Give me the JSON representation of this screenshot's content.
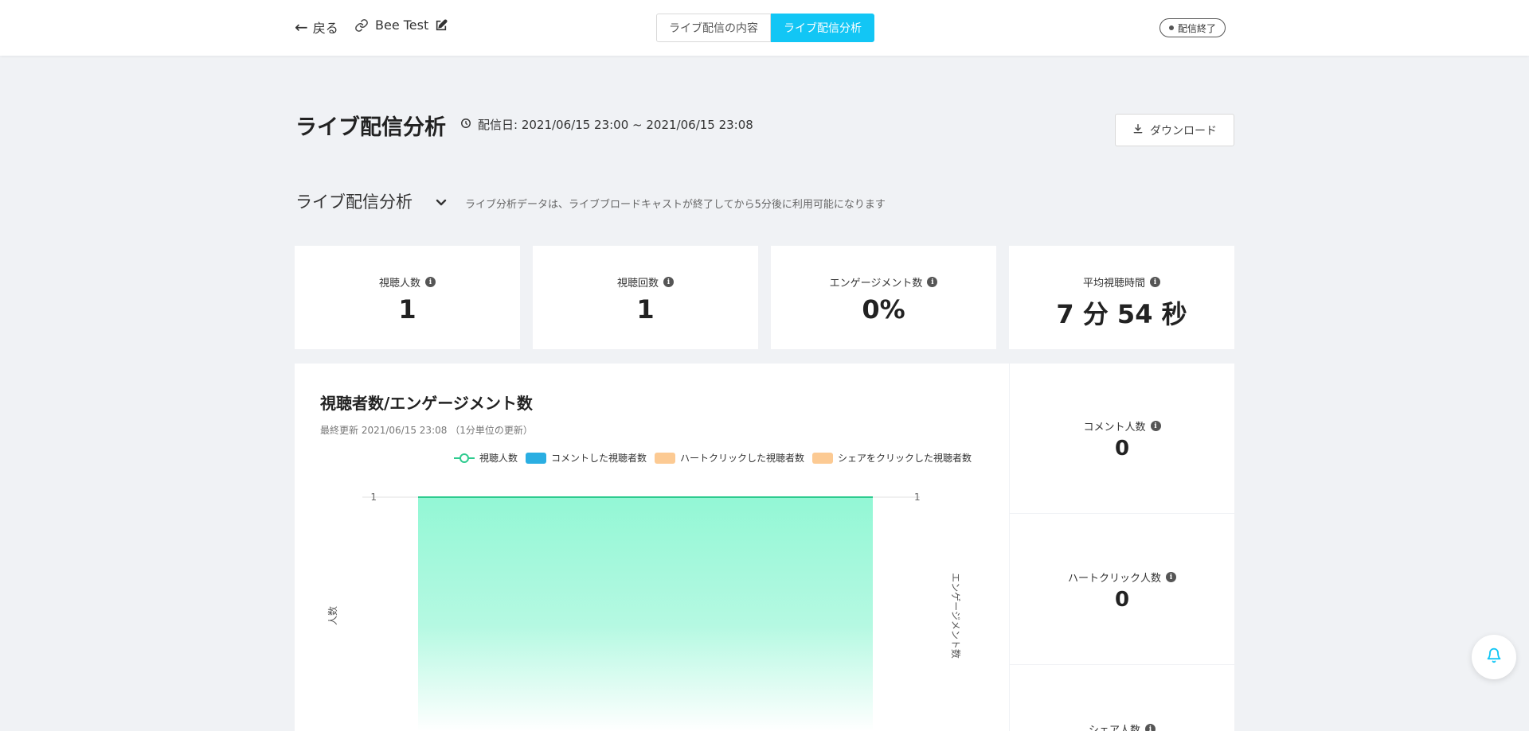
{
  "header": {
    "back_label": "戻る",
    "project_name": "Bee Test",
    "tabs": [
      {
        "label": "ライブ配信の内容",
        "active": false
      },
      {
        "label": "ライブ配信分析",
        "active": true
      }
    ],
    "status": "配信終了"
  },
  "page": {
    "title": "ライブ配信分析",
    "broadcast_date": "配信日: 2021/06/15 23:00 ~ 2021/06/15 23:08",
    "download_label": "ダウンロード"
  },
  "section": {
    "title": "ライブ配信分析",
    "note": "ライブ分析データは、ライブブロードキャストが終了してから5分後に利用可能になります"
  },
  "stats": [
    {
      "label": "視聴人数",
      "value": "1"
    },
    {
      "label": "視聴回数",
      "value": "1"
    },
    {
      "label": "エンゲージメント数",
      "value": "0%"
    },
    {
      "label": "平均視聴時間",
      "value": "7 分 54 秒"
    }
  ],
  "side_stats": [
    {
      "label": "コメント人数",
      "value": "0"
    },
    {
      "label": "ハートクリック人数",
      "value": "0"
    },
    {
      "label": "シェア人数",
      "value": ""
    }
  ],
  "colors": {
    "accent": "#12c6f5",
    "viewers": "#2ecb8f",
    "comments": "#2aaee2",
    "hearts": "#fcca93",
    "shares": "#fcca93"
  },
  "chart_data": {
    "type": "area",
    "title": "視聴者数/エンゲージメント数",
    "updated": "最終更新 2021/06/15 23:08 （1分単位の更新）",
    "ylabel": "人数",
    "y2label": "エンゲージメント数",
    "y_ticks": [
      "1"
    ],
    "y2_ticks": [
      "1"
    ],
    "ylim": [
      0,
      1
    ],
    "series": [
      {
        "name": "視聴人数",
        "type": "area",
        "values": [
          1,
          1
        ]
      },
      {
        "name": "コメントした視聴者数",
        "type": "bar",
        "values": []
      },
      {
        "name": "ハートクリックした視聴者数",
        "type": "bar",
        "values": []
      },
      {
        "name": "シェアをクリックした視聴者数",
        "type": "bar",
        "values": []
      }
    ]
  }
}
